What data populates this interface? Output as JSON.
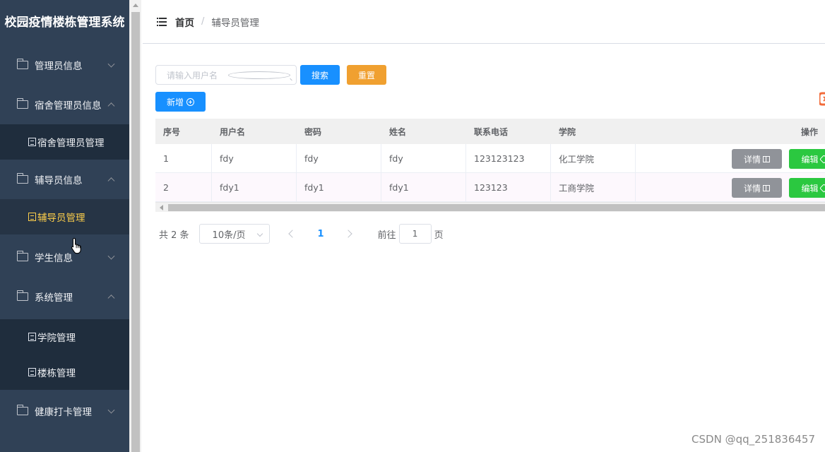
{
  "sidebar": {
    "title": "校园疫情楼栋管理系统",
    "groups": [
      {
        "label": "管理员信息"
      },
      {
        "label": "宿舍管理员信息"
      },
      {
        "label": "辅导员信息"
      },
      {
        "label": "学生信息"
      },
      {
        "label": "系统管理"
      },
      {
        "label": "健康打卡管理"
      }
    ],
    "subitems": [
      {
        "label": "宿舍管理员管理"
      },
      {
        "label": "辅导员管理"
      },
      {
        "label": "学院管理"
      },
      {
        "label": "楼栋管理"
      }
    ]
  },
  "breadcrumb": {
    "home": "首页",
    "separator": "/",
    "current": "辅导员管理"
  },
  "search": {
    "placeholder": "请输入用户名",
    "search_label": "搜索",
    "reset_label": "重置"
  },
  "toolbar": {
    "add_label": "新增"
  },
  "table": {
    "headers": [
      "序号",
      "用户名",
      "密码",
      "姓名",
      "联系电话",
      "学院",
      "操作"
    ],
    "rows": [
      [
        "1",
        "fdy",
        "fdy",
        "fdy",
        "123123123",
        "化工学院"
      ],
      [
        "2",
        "fdy1",
        "fdy1",
        "fdy1",
        "123123",
        "工商学院"
      ]
    ],
    "detail_label": "详情",
    "edit_label": "编辑"
  },
  "pagination": {
    "total_text": "共 2 条",
    "page_size": "10条/页",
    "current_page": "1",
    "goto_prefix": "前往",
    "goto_value": "1",
    "goto_suffix": "页"
  },
  "watermark": "CSDN @qq_251836457",
  "colors": {
    "sidebar_bg": "#304156",
    "active_text": "#ffd04b",
    "primary": "#1890ff",
    "warning": "#f0a030",
    "success": "#2bc840",
    "info": "#909399"
  }
}
